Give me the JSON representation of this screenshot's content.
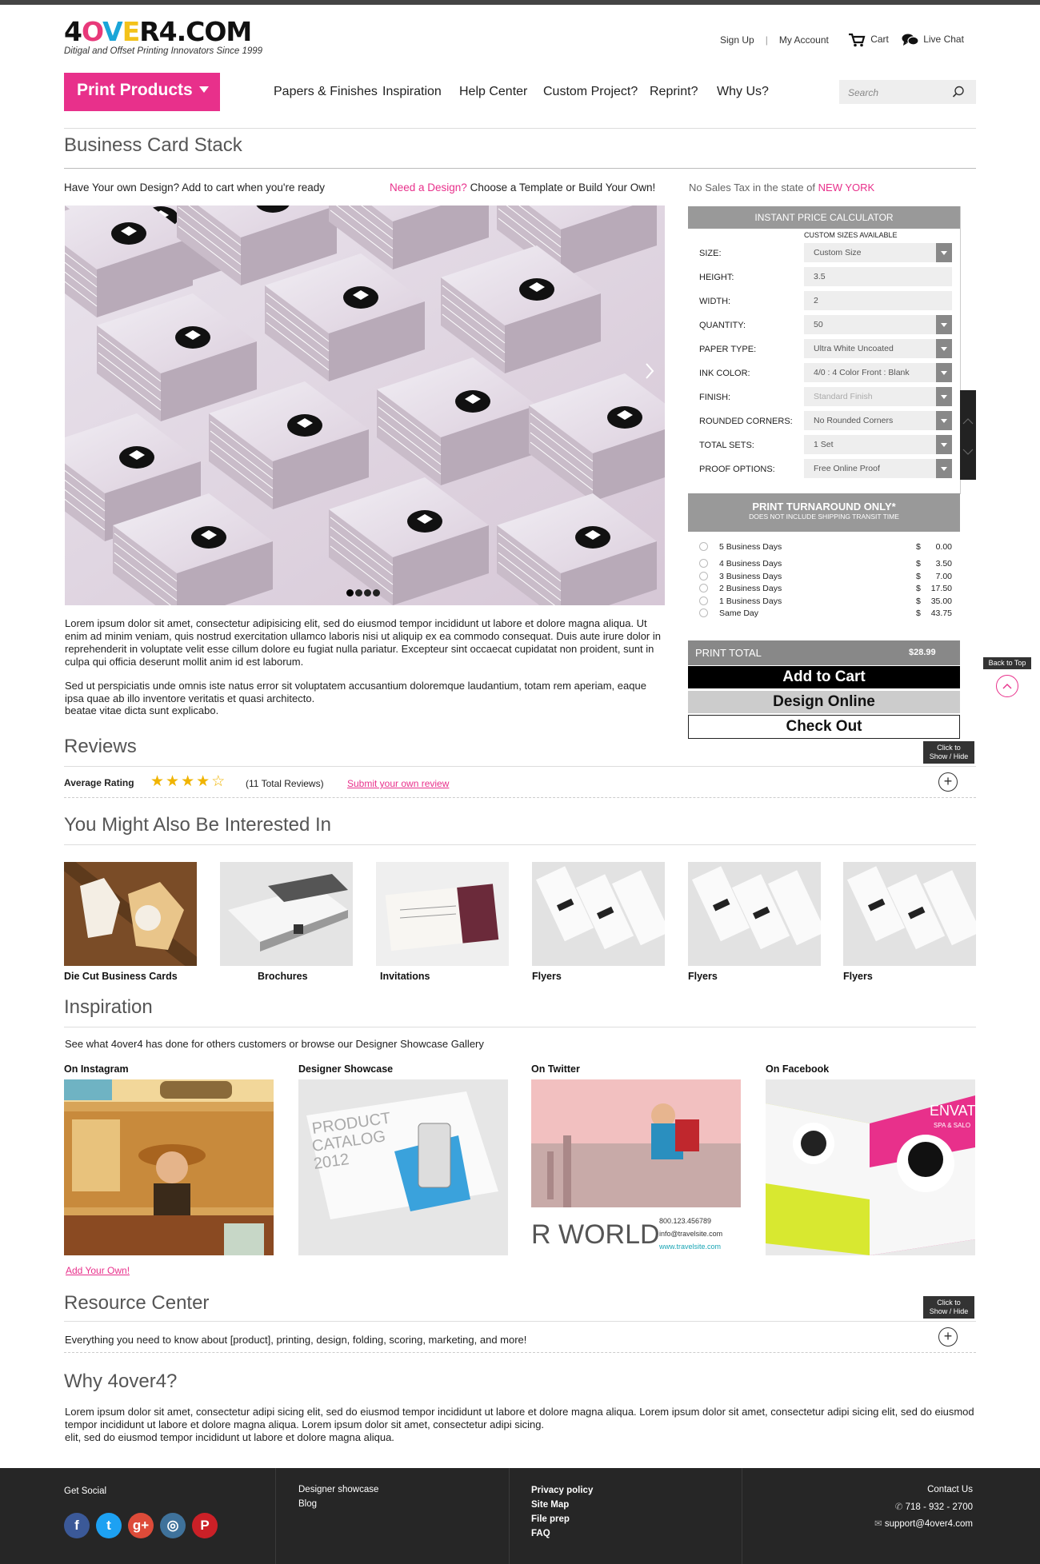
{
  "header": {
    "logo_text_a": "4",
    "logo_text_o": "O",
    "logo_text_v": "V",
    "logo_text_e": "E",
    "logo_text_b": "R4.COM",
    "tagline": "Ditigal and Offset Printing Innovators Since 1999",
    "signup": "Sign Up",
    "account": "My Account",
    "cart": "Cart",
    "chat": "Live Chat"
  },
  "nav": {
    "print_products": "Print Products",
    "items": [
      "Papers & Finishes",
      "Inspiration",
      "Help Center",
      "Custom Project?",
      "Reprint?",
      "Why Us?"
    ],
    "search_placeholder": "Search"
  },
  "product": {
    "title": "Business Card Stack",
    "own_design": "Have Your own Design?  Add to cart when you're ready",
    "need_design_link": "Need a Design?",
    "need_design_text": "Choose a Template or Build Your Own!",
    "tax_note": "No Sales Tax in the state of",
    "tax_state": "NEW YORK",
    "desc1": "Lorem ipsum dolor sit amet, consectetur adipisicing elit, sed do eiusmod tempor incididunt ut labore et dolore magna aliqua. Ut enim ad minim veniam, quis nostrud exercitation ullamco laboris nisi ut aliquip ex ea commodo consequat. Duis aute irure dolor in reprehenderit in voluptate velit esse cillum dolore eu fugiat nulla pariatur. Excepteur sint occaecat cupidatat non proident, sunt in culpa qui officia deserunt mollit anim id est laborum.",
    "desc2": "Sed ut perspiciatis unde omnis iste natus error sit voluptatem accusantium doloremque laudantium, totam rem aperiam, eaque ipsa quae ab illo inventore veritatis et quasi architecto.",
    "desc3": " beatae vitae dicta sunt explicabo.",
    "hero_slides": 4,
    "hero_active_slide": 1
  },
  "calculator": {
    "title": "INSTANT PRICE CALCULATOR",
    "custom_sizes": "CUSTOM SIZES AVAILABLE",
    "fields": [
      {
        "label": "SIZE:",
        "value": "Custom Size",
        "dropdown": true
      },
      {
        "label": "HEIGHT:",
        "value": "3.5",
        "dropdown": false
      },
      {
        "label": "WIDTH:",
        "value": "2",
        "dropdown": false
      },
      {
        "label": "QUANTITY:",
        "value": "50",
        "dropdown": true
      },
      {
        "label": "PAPER TYPE:",
        "value": "Ultra White Uncoated",
        "dropdown": true
      },
      {
        "label": "INK COLOR:",
        "value": "4/0 : 4 Color Front : Blank",
        "dropdown": true
      },
      {
        "label": "FINISH:",
        "value": "Standard Finish",
        "dropdown": true
      },
      {
        "label": "ROUNDED CORNERS:",
        "value": "No Rounded Corners",
        "dropdown": true
      },
      {
        "label": "TOTAL SETS:",
        "value": "1 Set",
        "dropdown": true
      },
      {
        "label": "PROOF OPTIONS:",
        "value": "Free Online Proof",
        "dropdown": true
      }
    ],
    "turnaround_title": "PRINT TURNAROUND ONLY*",
    "turnaround_sub": "DOES NOT INCLUDE SHIPPING TRANSIT TIME",
    "turnaround": [
      {
        "label": "5 Business Days",
        "currency": "$",
        "price": "0.00"
      },
      {
        "label": "4 Business Days",
        "currency": "$",
        "price": "3.50"
      },
      {
        "label": "3 Business Days",
        "currency": "$",
        "price": "7.00"
      },
      {
        "label": "2 Business Days",
        "currency": "$",
        "price": "17.50"
      },
      {
        "label": "1 Business Days",
        "currency": "$",
        "price": "35.00"
      },
      {
        "label": "Same Day",
        "currency": "$",
        "price": "43.75"
      }
    ],
    "total_label": "PRINT TOTAL",
    "total_value": "$28.99",
    "add_to_cart": "Add to Cart",
    "design_online": "Design Online",
    "check_out": "Check Out"
  },
  "side": {
    "back_to_top": "Back to Top",
    "toggle_tip_1": "Click to",
    "toggle_tip_2": "Show / Hide"
  },
  "reviews": {
    "title": "Reviews",
    "avg_label": "Average Rating",
    "rating": 4,
    "rating_max": 5,
    "total": "(11 Total Reviews)",
    "submit": "Submit your own review"
  },
  "related": {
    "title": "You Might Also Be Interested In",
    "items": [
      "Die Cut Business Cards",
      "Brochures",
      "Invitations",
      "Flyers",
      "Flyers",
      "Flyers"
    ]
  },
  "inspiration": {
    "title": "Inspiration",
    "intro": "See what 4over4 has done for others customers or browse our  Designer Showcase Gallery",
    "items": [
      "On Instagram",
      "Designer Showcase",
      "On Twitter",
      "On Facebook"
    ],
    "add_own": "Add Your Own!",
    "catalog_text_1": "PRODUCT",
    "catalog_text_2": "CATALOG",
    "catalog_text_3": "2012",
    "twitter_text": "R WORLD",
    "twitter_phone": "800.123.456789",
    "twitter_email": "info@travelsite.com",
    "twitter_web": "www.travelsite.com",
    "facebook_brand": "ENVATO",
    "facebook_sub": "SPA & SALO"
  },
  "resource": {
    "title": "Resource Center",
    "text": "Everything you need to know about [product], printing, design, folding, scoring, marketing, and more!"
  },
  "why": {
    "title": "Why 4over4?",
    "text1": "Lorem ipsum dolor sit amet, consectetur adipi sicing elit, sed do eiusmod tempor incididunt ut labore et dolore magna aliqua. Lorem ipsum dolor sit amet, consectetur adipi sicing elit, sed do eiusmod tempor incididunt ut labore et dolore magna aliqua. Lorem ipsum dolor sit amet, consectetur adipi sicing.",
    "text2": " elit, sed do eiusmod tempor incididunt ut labore et dolore magna aliqua."
  },
  "footer": {
    "get_social": "Get Social",
    "social": [
      {
        "name": "facebook-icon",
        "glyph": "f",
        "color": "#3b5998"
      },
      {
        "name": "twitter-icon",
        "glyph": "t",
        "color": "#1da1f2"
      },
      {
        "name": "google-plus-icon",
        "glyph": "g+",
        "color": "#dd4b39"
      },
      {
        "name": "instagram-icon",
        "glyph": "◎",
        "color": "#3f729b"
      },
      {
        "name": "pinterest-icon",
        "glyph": "P",
        "color": "#cb2027"
      }
    ],
    "col2": [
      "Designer showcase",
      "Blog"
    ],
    "col3": [
      "Privacy policy",
      "Site Map",
      "File prep",
      "FAQ"
    ],
    "contact": "Contact Us",
    "phone": "718 - 932 - 2700",
    "email": "support@4over4.com"
  },
  "colors": {
    "accent": "#e8308b",
    "calc_gray": "#999999",
    "footer_bg": "#262626"
  }
}
